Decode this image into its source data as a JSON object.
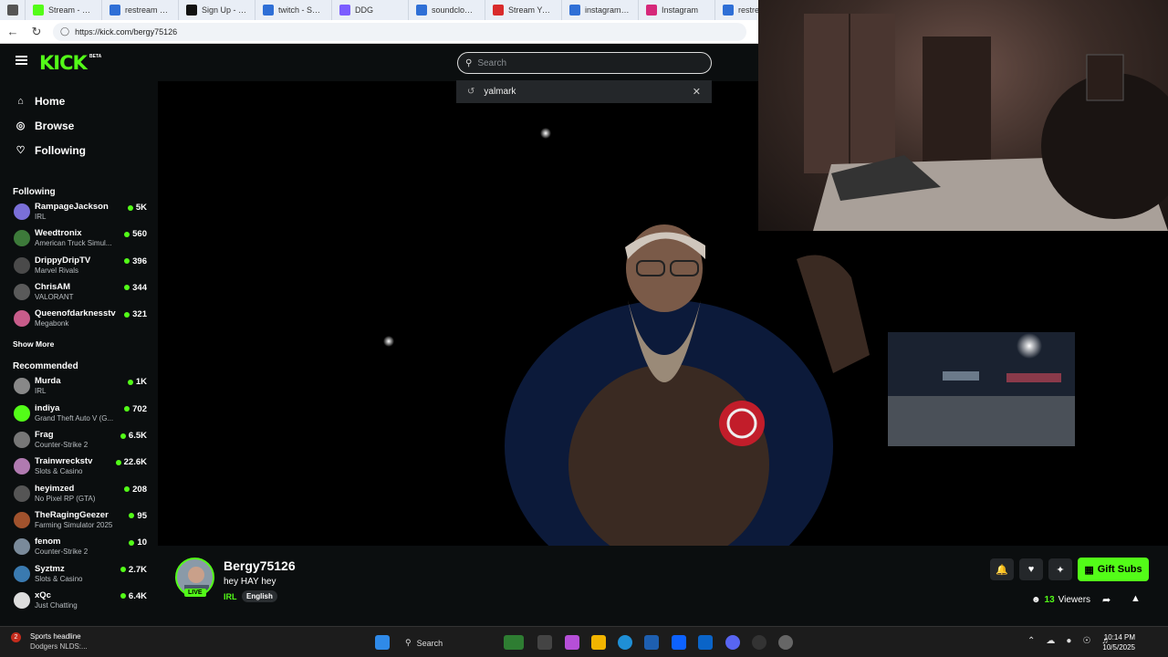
{
  "browser": {
    "tabs": [
      {
        "label": "",
        "color": "#555"
      },
      {
        "label": "Stream - Kick",
        "color": "#53fc18"
      },
      {
        "label": "restream - Search",
        "color": "#2f6fd6"
      },
      {
        "label": "Sign Up - Restream",
        "color": "#111"
      },
      {
        "label": "twitch - Search",
        "color": "#2f6fd6"
      },
      {
        "label": "DDG",
        "color": "#7b5cff"
      },
      {
        "label": "soundcloud - Search",
        "color": "#2f6fd6"
      },
      {
        "label": "Stream Yung",
        "color": "#d92b2b"
      },
      {
        "label": "instagram - Search",
        "color": "#2f6fd6"
      },
      {
        "label": "Instagram",
        "color": "#d6287a"
      },
      {
        "label": "restream",
        "color": "#2f6fd6"
      }
    ],
    "url": "https://kick.com/bergy75126"
  },
  "header": {
    "logo": "KICK",
    "beta": "BETA",
    "search_placeholder": "Search",
    "suggestion": "yalmark"
  },
  "sidebar": {
    "nav": [
      {
        "label": "Home",
        "icon": "home-icon"
      },
      {
        "label": "Browse",
        "icon": "compass-icon"
      },
      {
        "label": "Following",
        "icon": "heart-icon"
      }
    ],
    "following_title": "Following",
    "following": [
      {
        "name": "RampageJackson",
        "category": "IRL",
        "viewers": "5K",
        "color": "#7a6fd8"
      },
      {
        "name": "Weedtronix",
        "category": "American Truck Simul...",
        "viewers": "560",
        "color": "#3d7a3a"
      },
      {
        "name": "DrippyDripTV",
        "category": "Marvel Rivals",
        "viewers": "396",
        "color": "#4a4a4a"
      },
      {
        "name": "ChrisAM",
        "category": "VALORANT",
        "viewers": "344",
        "color": "#5a5a5a"
      },
      {
        "name": "Queenofdarknesstv",
        "category": "Megabonk",
        "viewers": "321",
        "color": "#c85c8a"
      }
    ],
    "show_more": "Show More",
    "recommended_title": "Recommended",
    "recommended": [
      {
        "name": "Murda",
        "category": "IRL",
        "viewers": "1K",
        "color": "#888"
      },
      {
        "name": "indiya",
        "category": "Grand Theft Auto V (G...",
        "viewers": "702",
        "color": "#53fc18"
      },
      {
        "name": "Frag",
        "category": "Counter-Strike 2",
        "viewers": "6.5K",
        "color": "#777"
      },
      {
        "name": "Trainwreckstv",
        "category": "Slots & Casino",
        "viewers": "22.6K",
        "color": "#b07ab0"
      },
      {
        "name": "heyimzed",
        "category": "No Pixel RP (GTA)",
        "viewers": "208",
        "color": "#555"
      },
      {
        "name": "TheRagingGeezer",
        "category": "Farming Simulator 2025",
        "viewers": "95",
        "color": "#a0522d"
      },
      {
        "name": "fenom",
        "category": "Counter-Strike 2",
        "viewers": "10",
        "color": "#7a8a9a"
      },
      {
        "name": "Syztmz",
        "category": "Slots & Casino",
        "viewers": "2.7K",
        "color": "#3a7ab0"
      },
      {
        "name": "xQc",
        "category": "Just Chatting",
        "viewers": "6.4K",
        "color": "#ddd"
      }
    ]
  },
  "stream": {
    "streamer": "Bergy75126",
    "title": "hey HAY hey",
    "category": "IRL",
    "language": "English",
    "live": "LIVE",
    "gift_label": "Gift Subs",
    "viewers_count": "13",
    "viewers_label": "Viewers"
  },
  "taskbar": {
    "news_badge": "2",
    "news_title": "Sports headline",
    "news_sub": "Dodgers NLDS:...",
    "search": "Search",
    "time": "10:14 PM",
    "date": "10/5/2025"
  }
}
